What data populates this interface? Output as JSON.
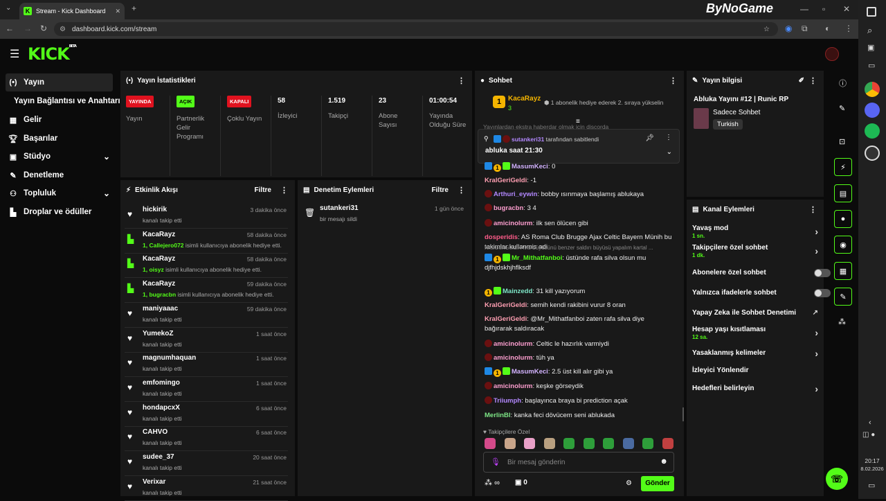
{
  "browser": {
    "tab_title": "Stream - Kick Dashboard",
    "url": "dashboard.kick.com/stream",
    "overlay_logo": "ByNoGame"
  },
  "brand": {
    "logo": "KICK",
    "beta": "BETA"
  },
  "sidebar": {
    "items": [
      {
        "label": "Yayın",
        "icon": "broadcast-icon"
      },
      {
        "label": "Yayın Bağlantısı ve Anahtarı",
        "icon": ""
      },
      {
        "label": "Gelir",
        "icon": "revenue-icon"
      },
      {
        "label": "Başarılar",
        "icon": "trophy-icon"
      },
      {
        "label": "Stüdyo",
        "icon": "studio-icon"
      },
      {
        "label": "Denetleme",
        "icon": "wrench-icon"
      },
      {
        "label": "Topluluk",
        "icon": "community-icon"
      },
      {
        "label": "Droplar ve ödüller",
        "icon": "gift-icon"
      }
    ]
  },
  "stats": {
    "title": "Yayın İstatistikleri",
    "items": [
      {
        "badge": "YAYINDA",
        "label": "Yayın"
      },
      {
        "badge": "AÇIK",
        "label": "Partnerlik Gelir Programı"
      },
      {
        "badge": "KAPALI",
        "label": "Çoklu Yayın"
      },
      {
        "value": "58",
        "label": "İzleyici"
      },
      {
        "value": "1.519",
        "label": "Takipçi"
      },
      {
        "value": "23",
        "label": "Abone Sayısı"
      },
      {
        "value": "01:00:54",
        "label": "Yayında Olduğu Süre"
      }
    ]
  },
  "activity": {
    "title": "Etkinlik Akışı",
    "filter": "Filtre",
    "items": [
      {
        "name": "hickirik",
        "time": "3 dakika önce",
        "desc": "kanalı takip etti",
        "type": "follow"
      },
      {
        "name": "KacaRayz",
        "time": "58 dakika önce",
        "desc_pre": "1, Callejero072",
        "desc": " isimli kullanıcıya abonelik hediye etti.",
        "type": "gift"
      },
      {
        "name": "KacaRayz",
        "time": "58 dakika önce",
        "desc_pre": "1, oisyz",
        "desc": " isimli kullanıcıya abonelik hediye etti.",
        "type": "gift"
      },
      {
        "name": "KacaRayz",
        "time": "59 dakika önce",
        "desc_pre": "1, bugracbn",
        "desc": " isimli kullanıcıya abonelik hediye etti.",
        "type": "gift"
      },
      {
        "name": "maniyaaac",
        "time": "59 dakika önce",
        "desc": "kanalı takip etti",
        "type": "follow"
      },
      {
        "name": "YumekoZ",
        "time": "1 saat önce",
        "desc": "kanalı takip etti",
        "type": "follow"
      },
      {
        "name": "magnumhaquan",
        "time": "1 saat önce",
        "desc": "kanalı takip etti",
        "type": "follow"
      },
      {
        "name": "emfomingo",
        "time": "1 saat önce",
        "desc": "kanalı takip etti",
        "type": "follow"
      },
      {
        "name": "hondapcxX",
        "time": "6 saat önce",
        "desc": "kanalı takip etti",
        "type": "follow"
      },
      {
        "name": "CAHVO",
        "time": "6 saat önce",
        "desc": "kanalı takip etti",
        "type": "follow"
      },
      {
        "name": "sudee_37",
        "time": "20 saat önce",
        "desc": "kanalı takip etti",
        "type": "follow"
      },
      {
        "name": "Verixar",
        "time": "21 saat önce",
        "desc": "kanalı takip etti",
        "type": "follow"
      }
    ]
  },
  "moderation": {
    "title": "Denetim Eylemleri",
    "filter": "Filtre",
    "items": [
      {
        "name": "sutankeri31",
        "time": "1 gün önce",
        "desc": "bir mesajı sildi"
      }
    ]
  },
  "chat": {
    "title": "Sohbet",
    "top_gifter": {
      "rank": "1",
      "name": "KacaRayz",
      "count": "3",
      "note": "1 abonelik hediye ederek 2. sıraya yükselin"
    },
    "pinned": {
      "by": "sutankeri31",
      "by_suffix": " tarafından sabitlendi",
      "text": "abluka saat 21:30"
    },
    "partial_top": "Yayınlardan ekstra haberdar olmak için discorda",
    "messages": [
      {
        "user": "MasumKeci",
        "text": "0",
        "color": "#d3b3ff",
        "badges": "bog"
      },
      {
        "user": "KralGeriGeldi",
        "text": "-1",
        "color": "#ff9fb2",
        "badges": ""
      },
      {
        "user": "Arthuri_eywin",
        "text": "bobby ısınmaya başlamış ablukaya",
        "color": "#b388ff",
        "badges": "r"
      },
      {
        "user": "bugracbn",
        "text": "3 4",
        "color": "#ff9fd0",
        "badges": "r"
      },
      {
        "user": "amicinolurm",
        "text": "ilk sen ölücen gibi",
        "color": "#ff9fd0",
        "badges": "r"
      },
      {
        "user": "dosperidis",
        "text": "AS Roma Club Brugge Ajax Celtic Bayern Münih bu takimlar kullanmis adi",
        "color": "#ff5c8a",
        "badges": ""
      },
      {
        "user": "Mr_Mithatfanboi",
        "text": "üstünde rafa silva olsun mu djfhjdskhjhflksdf",
        "color": "#53fc18",
        "badges": "bog",
        "reply": "KralGeriGeldi: Avis büyüsünü benzer saldırı büyüsü yapalım kartal ..."
      },
      {
        "user": "Mainzedd",
        "text": "31 kill yazıyorum",
        "color": "#7ee7c8",
        "badges": "og"
      },
      {
        "user": "KralGeriGeldi",
        "text": "semih kendi rakibini vurur 8 oran",
        "color": "#ff9fb2",
        "badges": ""
      },
      {
        "user": "KralGeriGeldi",
        "text": "@Mr_Mithatfanboi zaten rafa silva diye bağırarak saldıracak",
        "color": "#ff9fb2",
        "badges": ""
      },
      {
        "user": "amicinolurm",
        "text": "Celtic le hazırlık varmiydi",
        "color": "#ff9fd0",
        "badges": "r"
      },
      {
        "user": "amicinolurm",
        "text": "tüh ya",
        "color": "#ff9fd0",
        "badges": "r"
      },
      {
        "user": "MasumKeci",
        "text": "2.5 üst kill alır gibi ya",
        "color": "#d3b3ff",
        "badges": "bog"
      },
      {
        "user": "amicinolurm",
        "text": "keşke görseydik",
        "color": "#ff9fd0",
        "badges": "r"
      },
      {
        "user": "Triiumph",
        "text": "başlayınca braya bi prediction açak",
        "color": "#b388ff",
        "badges": "r"
      },
      {
        "user": "MerlinBl",
        "text": "kanka feci dövücem seni ablukada",
        "color": "#7ee787",
        "badges": ""
      }
    ],
    "emote_label": "Takipçilere Özel",
    "input_placeholder": "Bir mesaj gönderin",
    "points": "∞",
    "count": "0",
    "send_label": "Gönder"
  },
  "stream_info": {
    "title": "Yayın bilgisi",
    "stream_title": "Abluka Yayını #12 | Runic RP",
    "category": "Sadece Sohbet",
    "tag": "Turkish"
  },
  "channel_actions": {
    "title": "Kanal Eylemleri",
    "items": [
      {
        "label": "Yavaş mod",
        "sub": "1 sn.",
        "control": "arrow"
      },
      {
        "label": "Takipçilere özel sohbet",
        "sub": "1 dk.",
        "control": "arrow"
      },
      {
        "label": "Abonelere özel sohbet",
        "sub": "",
        "control": "toggle"
      },
      {
        "label": "Yalnızca ifadelerle sohbet",
        "sub": "",
        "control": "toggle"
      },
      {
        "label": "Yapay Zeka ile Sohbet Denetimi",
        "sub": "",
        "control": "external"
      },
      {
        "label": "Hesap yaşı kısıtlaması",
        "sub": "12 sa.",
        "control": "arrow"
      },
      {
        "label": "Yasaklanmış kelimeler",
        "sub": "",
        "control": "arrow"
      },
      {
        "label": "İzleyici Yönlendir",
        "sub": "",
        "control": "none"
      },
      {
        "label": "Hedefleri belirleyin",
        "sub": "",
        "control": "arrow"
      }
    ]
  },
  "taskbar": {
    "time": "20:17",
    "date": "8.02.2026"
  },
  "colors": {
    "accent": "#53fc18",
    "panel": "#191919",
    "live": "#e0121f"
  }
}
